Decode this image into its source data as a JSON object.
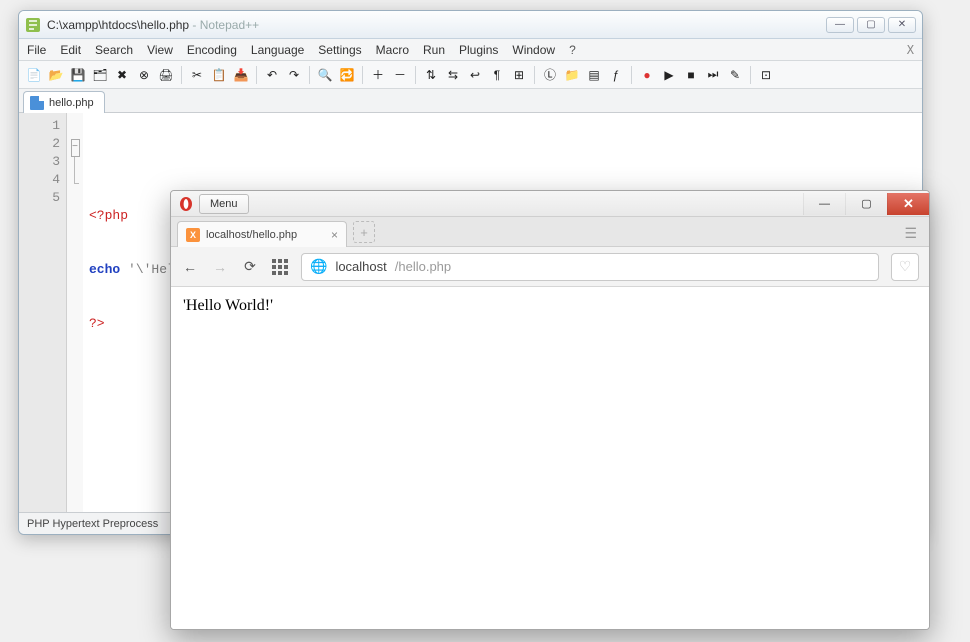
{
  "notepadpp": {
    "title_path": "C:\\xampp\\htdocs\\hello.php",
    "title_app": " - Notepad++",
    "menu": [
      "File",
      "Edit",
      "Search",
      "View",
      "Encoding",
      "Language",
      "Settings",
      "Macro",
      "Run",
      "Plugins",
      "Window",
      "?"
    ],
    "toolbar_icons": [
      {
        "name": "new-file-icon",
        "glyph": "📄"
      },
      {
        "name": "open-icon",
        "glyph": "📂"
      },
      {
        "name": "save-icon",
        "glyph": "💾"
      },
      {
        "name": "save-all-icon",
        "glyph": "🗂"
      },
      {
        "name": "close-icon",
        "glyph": "✖"
      },
      {
        "name": "close-all-icon",
        "glyph": "⊗"
      },
      {
        "name": "print-icon",
        "glyph": "🖨"
      },
      {
        "name": "sep"
      },
      {
        "name": "cut-icon",
        "glyph": "✂"
      },
      {
        "name": "copy-icon",
        "glyph": "📋"
      },
      {
        "name": "paste-icon",
        "glyph": "📥"
      },
      {
        "name": "sep"
      },
      {
        "name": "undo-icon",
        "glyph": "↶"
      },
      {
        "name": "redo-icon",
        "glyph": "↷"
      },
      {
        "name": "sep"
      },
      {
        "name": "find-icon",
        "glyph": "🔍"
      },
      {
        "name": "replace-icon",
        "glyph": "🔁"
      },
      {
        "name": "sep"
      },
      {
        "name": "zoom-in-icon",
        "glyph": "＋"
      },
      {
        "name": "zoom-out-icon",
        "glyph": "－"
      },
      {
        "name": "sep"
      },
      {
        "name": "sync-v-icon",
        "glyph": "⇅"
      },
      {
        "name": "sync-h-icon",
        "glyph": "⇆"
      },
      {
        "name": "wrap-icon",
        "glyph": "↩"
      },
      {
        "name": "all-chars-icon",
        "glyph": "¶"
      },
      {
        "name": "indent-guide-icon",
        "glyph": "⊞"
      },
      {
        "name": "sep"
      },
      {
        "name": "lang-icon",
        "glyph": "Ⓛ"
      },
      {
        "name": "folder-icon",
        "glyph": "📁"
      },
      {
        "name": "doc-map-icon",
        "glyph": "▤"
      },
      {
        "name": "func-list-icon",
        "glyph": "ƒ"
      },
      {
        "name": "sep"
      },
      {
        "name": "record-icon",
        "glyph": "●",
        "color": "#d33"
      },
      {
        "name": "play-icon",
        "glyph": "▶"
      },
      {
        "name": "stop-icon",
        "glyph": "■"
      },
      {
        "name": "play-multi-icon",
        "glyph": "⏭"
      },
      {
        "name": "save-macro-icon",
        "glyph": "✎"
      },
      {
        "name": "sep"
      },
      {
        "name": "plugin-icon",
        "glyph": "⊡"
      }
    ],
    "tab_label": "hello.php",
    "code": {
      "lines": [
        "1",
        "2",
        "3",
        "4",
        "5"
      ],
      "l2_open": "<?php",
      "l3_kw": "echo",
      "l3_str": " '\\'Hello World!\\'';",
      "l4_close": "?>"
    },
    "status": "PHP Hypertext Preprocess"
  },
  "opera": {
    "menu_label": "Menu",
    "tab": {
      "title": "localhost/hello.php"
    },
    "address": {
      "host": "localhost",
      "path": "/hello.php"
    },
    "page_output": "'Hello World!'"
  }
}
